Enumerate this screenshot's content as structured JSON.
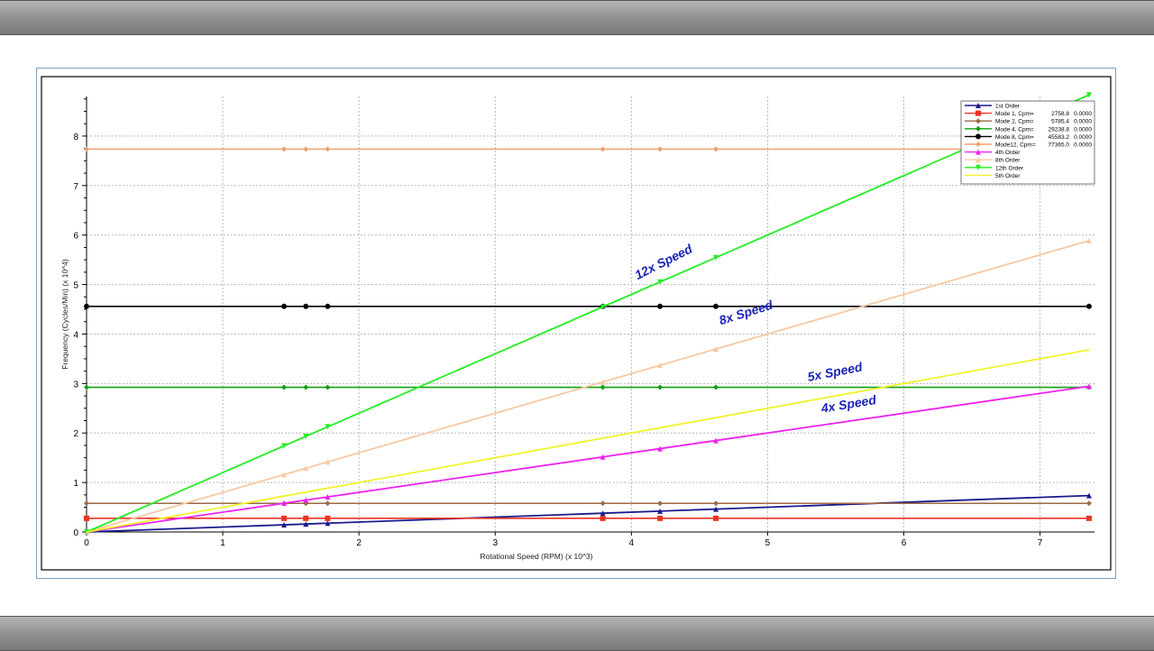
{
  "chart_data": {
    "type": "line",
    "xlabel": "Rotational Speed (RPM)  (x 10^3)",
    "ylabel": "Frequency (Cycles/Min)  (x 10^4)",
    "xlim": [
      0,
      7.4
    ],
    "ylim": [
      0,
      8.8
    ],
    "xticks": [
      0,
      1,
      2,
      3,
      4,
      5,
      6,
      7
    ],
    "yticks": [
      0,
      1,
      2,
      3,
      4,
      5,
      6,
      7,
      8
    ],
    "grid": true,
    "legend_position": "top-right",
    "series": [
      {
        "name": "1st Order",
        "color": "#1a1a8c",
        "marker": "triangle",
        "x": [
          0,
          1.45,
          1.61,
          1.77,
          3.79,
          4.21,
          4.62,
          7.36
        ],
        "y": [
          0,
          0.145,
          0.161,
          0.177,
          0.379,
          0.421,
          0.462,
          0.736
        ]
      },
      {
        "name": "Mode 1, Cpm=",
        "cpm": "2758.8",
        "extra": "0.0000",
        "color": "#ee3322",
        "marker": "square",
        "x": [
          0,
          1.45,
          1.61,
          1.77,
          3.79,
          4.21,
          4.62,
          7.36
        ],
        "y": [
          0.2759,
          0.2759,
          0.2759,
          0.2759,
          0.2759,
          0.2759,
          0.2759,
          0.2759
        ]
      },
      {
        "name": "Mode 2, Cpm=",
        "cpm": "5785.4",
        "extra": "0.0000",
        "color": "#9b6a45",
        "marker": "diamond",
        "x": [
          0,
          1.45,
          1.61,
          1.77,
          3.79,
          4.21,
          4.62,
          7.36
        ],
        "y": [
          0.5785,
          0.5785,
          0.5785,
          0.5785,
          0.5785,
          0.5785,
          0.5785,
          0.5785
        ]
      },
      {
        "name": "Mode 4, Cpm=",
        "cpm": "29238.8",
        "extra": "0.0000",
        "color": "#11a011",
        "marker": "diamond",
        "x": [
          0,
          1.45,
          1.61,
          1.77,
          3.79,
          4.21,
          4.62,
          7.36
        ],
        "y": [
          2.9239,
          2.9239,
          2.9239,
          2.9239,
          2.9239,
          2.9239,
          2.9239,
          2.9239
        ]
      },
      {
        "name": "Mode 8, Cpm=",
        "cpm": "45583.2",
        "extra": "0.0000",
        "color": "#000000",
        "marker": "circle",
        "x": [
          0,
          1.45,
          1.61,
          1.77,
          3.79,
          4.21,
          4.62,
          7.36
        ],
        "y": [
          4.5583,
          4.5583,
          4.5583,
          4.5583,
          4.5583,
          4.5583,
          4.5583,
          4.5583
        ]
      },
      {
        "name": "Mode12, Cpm=",
        "cpm": "77365.0",
        "extra": "0.0000",
        "color": "#f0a06e",
        "marker": "diamond",
        "x": [
          0,
          1.45,
          1.61,
          1.77,
          3.79,
          4.21,
          4.62,
          7.36
        ],
        "y": [
          7.7365,
          7.7365,
          7.7365,
          7.7365,
          7.7365,
          7.7365,
          7.7365,
          7.7365
        ]
      },
      {
        "name": "4th Order",
        "color": "#ee22ee",
        "marker": "triangle",
        "x": [
          0,
          1.45,
          1.61,
          1.77,
          3.79,
          4.21,
          4.62,
          7.36
        ],
        "y": [
          0,
          0.58,
          0.644,
          0.708,
          1.516,
          1.684,
          1.848,
          2.944
        ]
      },
      {
        "name": "8th Order",
        "color": "#f7c8a2",
        "marker": "triangle",
        "x": [
          0,
          1.45,
          1.61,
          1.77,
          3.79,
          4.21,
          4.62,
          7.36
        ],
        "y": [
          0,
          1.16,
          1.288,
          1.416,
          3.032,
          3.368,
          3.696,
          5.888
        ]
      },
      {
        "name": "12th Order",
        "color": "#22ee22",
        "marker": "triangle-down",
        "x": [
          0,
          1.45,
          1.61,
          1.77,
          3.79,
          4.21,
          4.62,
          7.36
        ],
        "y": [
          0,
          1.74,
          1.932,
          2.124,
          4.548,
          5.052,
          5.544,
          8.832
        ]
      },
      {
        "name": "5th Order",
        "color": "#f2f22a",
        "marker": "none",
        "x": [
          0,
          7.36
        ],
        "y": [
          0,
          3.68
        ]
      }
    ],
    "annotations": [
      {
        "text": "12x Speed",
        "x": 4.25,
        "y": 5.38,
        "angle": -26.8
      },
      {
        "text": "8x Speed",
        "x": 4.85,
        "y": 4.35,
        "angle": -17.3
      },
      {
        "text": "5x Speed",
        "x": 5.5,
        "y": 3.15,
        "angle": -11.1
      },
      {
        "text": "4x Speed",
        "x": 5.6,
        "y": 2.5,
        "angle": -9.2
      }
    ],
    "annotation_color": "#1a24b8"
  }
}
